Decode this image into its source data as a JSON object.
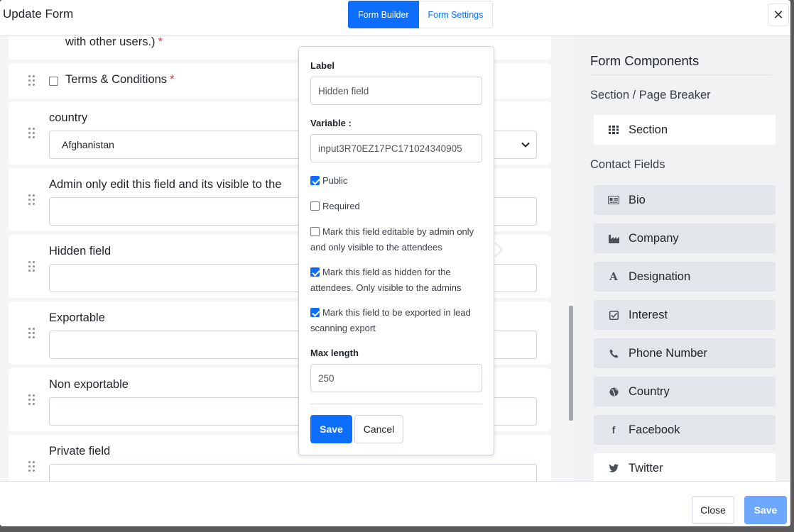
{
  "header": {
    "title": "Update Form",
    "tabs": [
      {
        "label": "Form Builder",
        "active": true
      },
      {
        "label": "Form Settings",
        "active": false
      }
    ],
    "close_symbol": "✕"
  },
  "fields": [
    {
      "label": "with other users.)",
      "required": true,
      "type": "checkbox"
    },
    {
      "label": "Terms & Conditions",
      "required": true,
      "type": "checkbox"
    },
    {
      "label": "country",
      "type": "select",
      "value": "Afghanistan"
    },
    {
      "label": "Admin only edit this field and its visible to the",
      "type": "text"
    },
    {
      "label": "Hidden field",
      "type": "text"
    },
    {
      "label": "Exportable",
      "type": "text"
    },
    {
      "label": "Non exportable",
      "type": "text"
    },
    {
      "label": "Private field",
      "type": "text"
    }
  ],
  "required_mark": "*",
  "popover": {
    "label_title": "Label",
    "label_value": "Hidden field",
    "variable_title": "Variable :",
    "variable_value": "input3R70EZ17PC171024340905",
    "options": [
      {
        "text": "Public",
        "checked": true
      },
      {
        "text": "Required",
        "checked": false
      },
      {
        "text": "Mark this field editable by admin only and only visible to the attendees",
        "checked": false
      },
      {
        "text": "Mark this field as hidden for the attendees. Only visible to the admins",
        "checked": true
      },
      {
        "text": "Mark this field to be exported in lead scanning export",
        "checked": true
      }
    ],
    "max_length_title": "Max length",
    "max_length_value": "250",
    "save_label": "Save",
    "cancel_label": "Cancel"
  },
  "sidebar": {
    "title": "Form Components",
    "section_group": "Section / Page Breaker",
    "section_item": {
      "label": "Section",
      "icon": "grid-icon"
    },
    "contact_group": "Contact Fields",
    "items": [
      {
        "label": "Bio",
        "icon": "id-card-icon"
      },
      {
        "label": "Company",
        "icon": "industry-icon"
      },
      {
        "label": "Designation",
        "icon": "font-icon"
      },
      {
        "label": "Interest",
        "icon": "check-square-icon"
      },
      {
        "label": "Phone Number",
        "icon": "phone-icon"
      },
      {
        "label": "Country",
        "icon": "globe-icon"
      },
      {
        "label": "Facebook",
        "icon": "facebook-icon"
      },
      {
        "label": "Twitter",
        "icon": "twitter-icon"
      }
    ]
  },
  "footer": {
    "close_label": "Close",
    "save_label": "Save"
  },
  "colors": {
    "primary": "#0d6efd",
    "primary_disabled": "#6ea8fe",
    "required": "#dc3545"
  }
}
